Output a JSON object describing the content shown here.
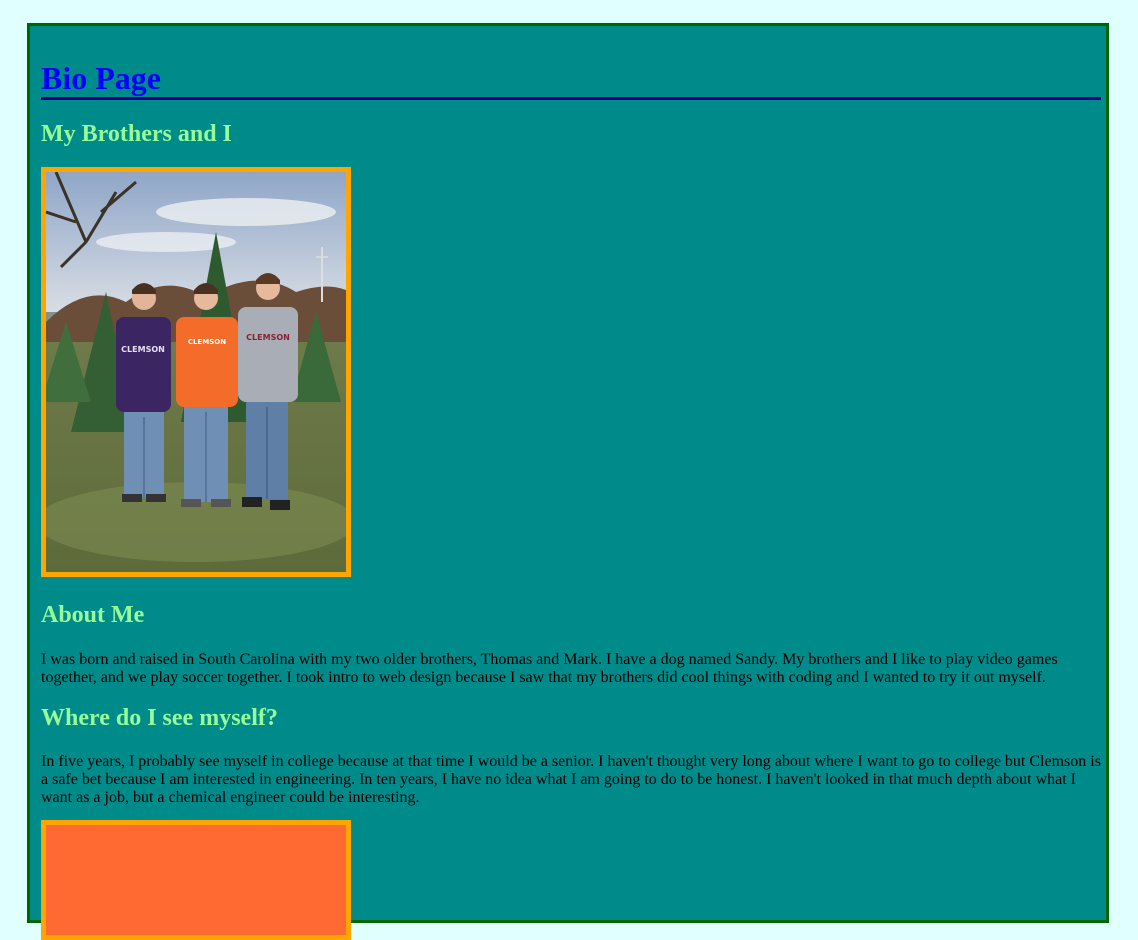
{
  "page": {
    "title": "Bio Page"
  },
  "sections": {
    "brothers": {
      "heading": "My Brothers and I"
    },
    "about": {
      "heading": "About Me",
      "text": "I was born and raised in South Carolina with my two older brothers, Thomas and Mark. I have a dog named Sandy. My brothers and I like to play video games together, and we play soccer together. I took intro to web design because I saw that my brothers did cool things with coding and I wanted to try it out myself."
    },
    "future": {
      "heading": "Where do I see myself?",
      "text": "In five years, I probably see myself in college because at that time I would be a senior. I haven't thought very long about where I want to go to college but Clemson is a safe bet because I am interested in engineering. In ten years, I have no idea what I am going to do to be honest. I haven't looked in that much depth about what I want as a job, but a chemical engineer could be interesting."
    }
  },
  "photo": {
    "shirt_labels": [
      "CLEMSON",
      "CLEMSON",
      "CLEMSON"
    ]
  },
  "colors": {
    "page_bg": "#e0ffff",
    "frame_bg": "#008b8b",
    "frame_border": "#006400",
    "title": "#0000ff",
    "title_rule": "#00008b",
    "heading": "#98fb98",
    "photo_border": "#ffa500"
  }
}
